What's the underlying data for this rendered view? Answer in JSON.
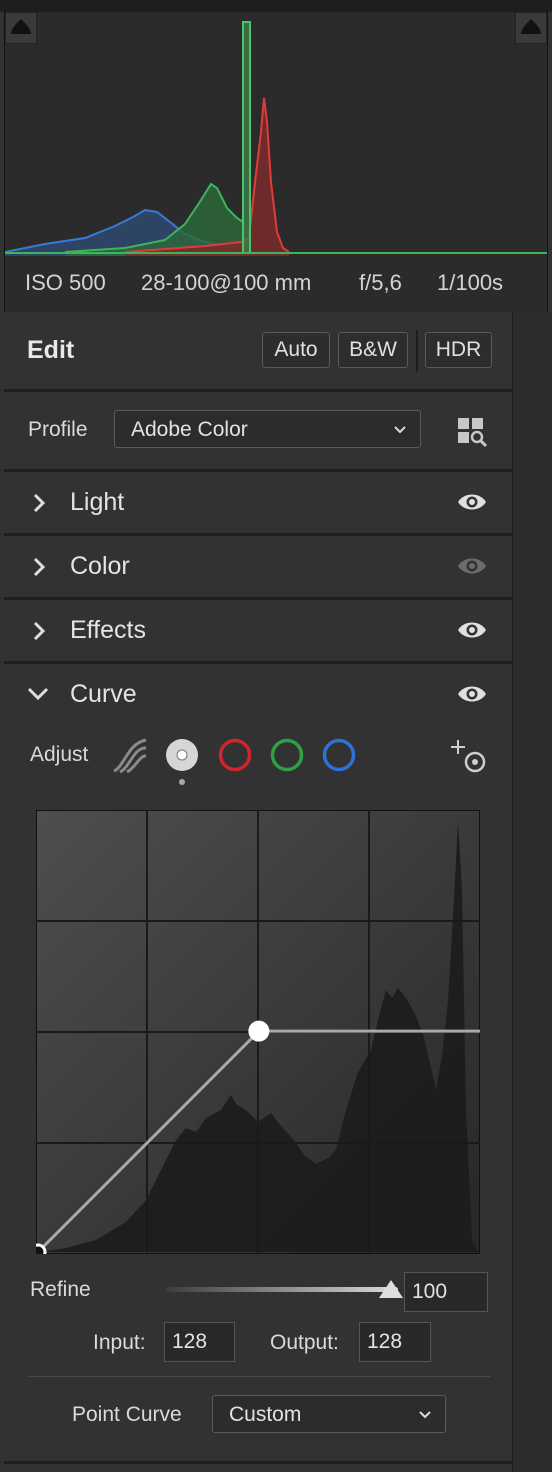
{
  "histogram": {
    "exif": {
      "iso": "ISO 500",
      "lens": "28-100@100 mm",
      "aperture": "f/5,6",
      "shutter": "1/100s"
    }
  },
  "edit": {
    "title": "Edit",
    "buttons": {
      "auto": "Auto",
      "bw": "B&W",
      "hdr": "HDR"
    },
    "profile": {
      "label": "Profile",
      "value": "Adobe Color"
    }
  },
  "sections": {
    "light": "Light",
    "color": "Color",
    "effects": "Effects",
    "curve": "Curve"
  },
  "curve": {
    "adjust_label": "Adjust",
    "channels": [
      "parametric",
      "point",
      "red",
      "green",
      "blue"
    ],
    "selected_channel": "point",
    "colors": {
      "red": "#d0252c",
      "green": "#2fa043",
      "blue": "#2b73d6"
    },
    "points": [
      {
        "input": 0,
        "output": 0
      },
      {
        "input": 128,
        "output": 128
      }
    ],
    "refine_label": "Refine",
    "refine_value": "100",
    "refine_fraction": 0.97,
    "input_label": "Input:",
    "input_value": "128",
    "output_label": "Output:",
    "output_value": "128",
    "point_curve_label": "Point Curve",
    "point_curve_value": "Custom"
  }
}
